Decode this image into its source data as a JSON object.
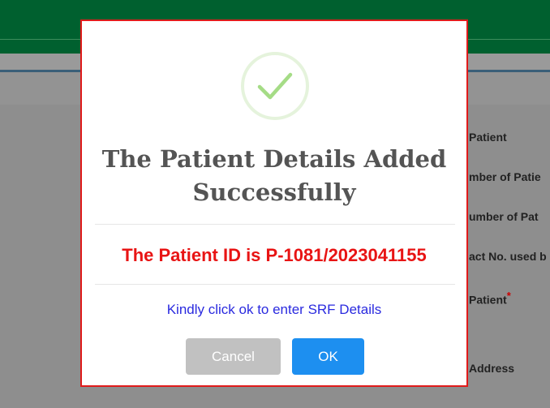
{
  "background_form": {
    "labels": [
      "Patient",
      "mber of Patie",
      "umber of Pat",
      "act No. used b",
      "Patient",
      "Address"
    ],
    "required_marker": "*"
  },
  "dialog": {
    "title_line1": "The Patient Details Added",
    "title_line2": "Successfully",
    "patient_id_text": "The Patient ID is P-1081/2023041155",
    "instruction": "Kindly click ok to enter SRF Details",
    "cancel_label": "Cancel",
    "ok_label": "OK",
    "success_icon": "check-icon"
  },
  "colors": {
    "header_green": "#00602f",
    "dialog_border": "#e01b1b",
    "patient_id_red": "#e81414",
    "instruction_blue": "#2a2adf",
    "ok_blue": "#1d8ff0",
    "cancel_gray": "#c1c1c1",
    "check_green": "#a5dc86"
  }
}
